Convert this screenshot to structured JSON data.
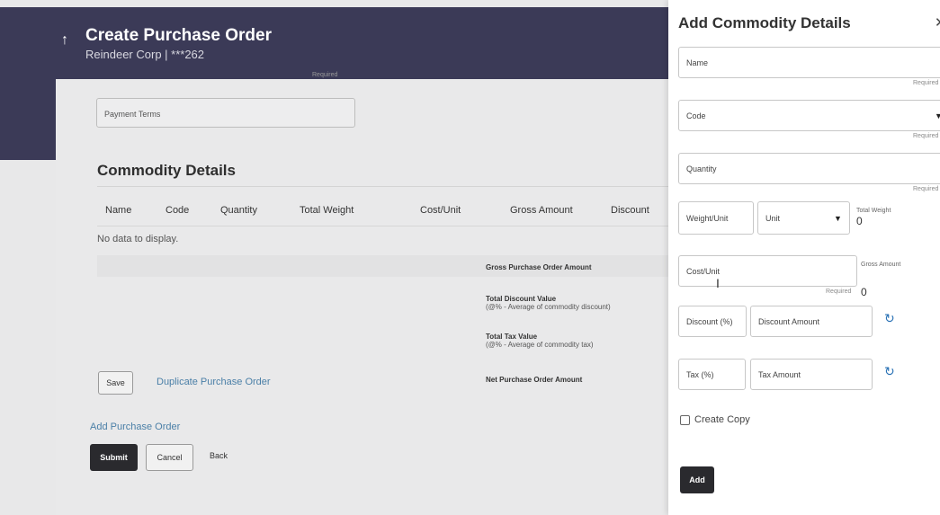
{
  "header": {
    "back_icon": "up-arrow-icon",
    "title": "Create Purchase Order",
    "subtitle": "Reindeer Corp | ***262"
  },
  "form": {
    "required_hint": "Required",
    "payment_terms_label": "Payment Terms"
  },
  "commodity": {
    "section_title": "Commodity Details",
    "columns": [
      "Name",
      "Code",
      "Quantity",
      "Total Weight",
      "Cost/Unit",
      "Gross Amount",
      "Discount"
    ],
    "empty_text": "No data to display."
  },
  "summary": {
    "gross_label": "Gross Purchase Order Amount",
    "total_discount_label": "Total Discount Value",
    "total_discount_sub": "(@% - Average of commodity discount)",
    "total_tax_label": "Total Tax Value",
    "total_tax_sub": "(@% - Average of commodity tax)",
    "net_label": "Net Purchase Order Amount"
  },
  "actions": {
    "save": "Save",
    "duplicate": "Duplicate Purchase Order",
    "add_po": "Add Purchase Order",
    "submit": "Submit",
    "cancel": "Cancel",
    "back": "Back"
  },
  "drawer": {
    "title": "Add Commodity Details",
    "close_icon": "close-icon",
    "name_label": "Name",
    "code_label": "Code",
    "quantity_label": "Quantity",
    "required": "Required",
    "weight_unit_label": "Weight/Unit",
    "unit_label": "Unit",
    "total_weight_label": "Total Weight",
    "total_weight_value": "0",
    "cost_unit_label": "Cost/Unit",
    "gross_amount_label": "Gross Amount",
    "gross_amount_value": "0",
    "discount_pct_label": "Discount (%)",
    "discount_amount_label": "Discount Amount",
    "tax_pct_label": "Tax (%)",
    "tax_amount_label": "Tax Amount",
    "refresh_icon": "refresh-icon",
    "create_copy_label": "Create Copy",
    "create_copy_checked": false,
    "add_button": "Add"
  }
}
